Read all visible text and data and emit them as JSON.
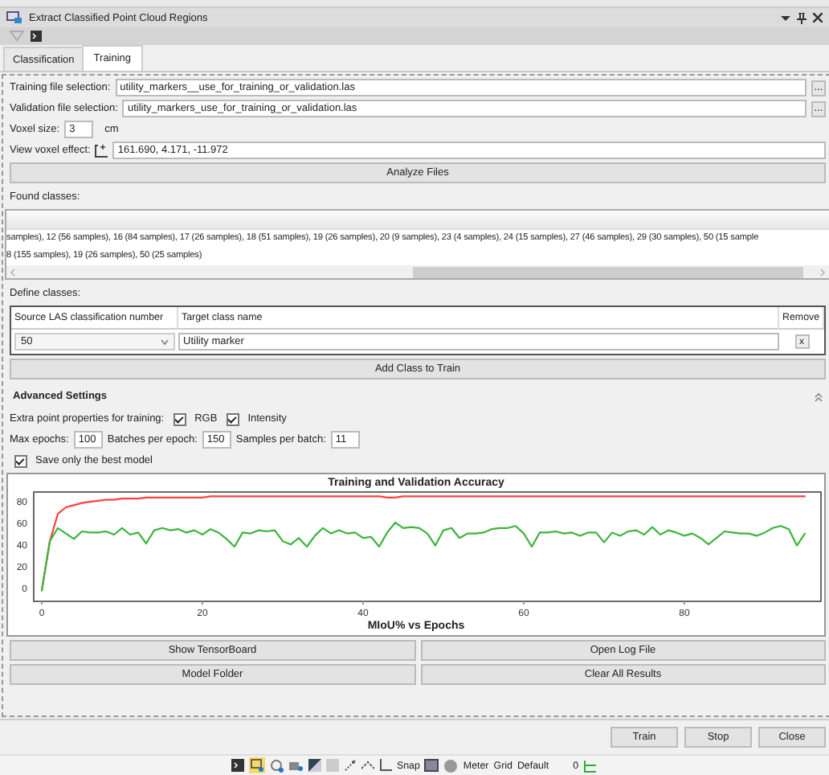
{
  "window": {
    "title": "Extract Classified Point Cloud Regions"
  },
  "tabs": [
    {
      "label": "Classification",
      "selected": false
    },
    {
      "label": "Training",
      "selected": true
    }
  ],
  "files": [
    {
      "label": "Training file selection:",
      "value": "utility_markers__use_for_training_or_validation.las",
      "browse": "..."
    },
    {
      "label": "Validation file selection:",
      "value": "utility_markers_use_for_training_or_validation.las",
      "browse": "..."
    }
  ],
  "voxel": {
    "label": "Voxel size:",
    "value": "3",
    "unit": "cm"
  },
  "view_voxel": {
    "label": "View voxel effect:",
    "value": "161.690, 4.171, -11.972"
  },
  "analyze_button": "Analyze Files",
  "found": {
    "label": "Found classes:",
    "lines": [
      "samples), 12 (56 samples), 16 (84 samples), 17 (26 samples), 18 (51 samples), 19 (26 samples), 20 (9 samples), 23 (4 samples), 24 (15 samples), 27 (46 samples), 29 (30 samples), 50 (15 sample",
      "8 (155 samples), 19 (26 samples), 50 (25 samples)"
    ]
  },
  "define": {
    "label": "Define classes:",
    "columns": [
      "Source LAS classification number",
      "Target class name",
      "Remove"
    ],
    "rows": [
      {
        "source": "50",
        "target": "Utility marker",
        "remove": "x"
      }
    ]
  },
  "add_button": "Add Class to Train",
  "advanced": {
    "title": "Advanced Settings",
    "extra_label": "Extra point properties for training:",
    "properties": [
      {
        "label": "RGB",
        "checked": true
      },
      {
        "label": "Intensity",
        "checked": true
      }
    ],
    "numbers": [
      {
        "label": "Max epochs:",
        "value": "100"
      },
      {
        "label": "Batches per epoch:",
        "value": "150"
      },
      {
        "label": "Samples per batch:",
        "value": "11"
      }
    ],
    "save_best": {
      "label": "Save only the best model",
      "checked": true
    }
  },
  "chart_data": {
    "type": "line",
    "title": "Training and Validation Accuracy",
    "xlabel": "MIoU% vs Epochs",
    "x": [
      0,
      1,
      2,
      3,
      4,
      5,
      6,
      7,
      8,
      9,
      10,
      11,
      12,
      13,
      14,
      15,
      16,
      17,
      18,
      19,
      20,
      21,
      22,
      23,
      24,
      25,
      26,
      27,
      28,
      29,
      30,
      31,
      32,
      33,
      34,
      35,
      36,
      37,
      38,
      39,
      40,
      41,
      42,
      43,
      44,
      45,
      46,
      47,
      48,
      49,
      50,
      51,
      52,
      53,
      54,
      55,
      56,
      57,
      58,
      59,
      60,
      61,
      62,
      63,
      64,
      65,
      66,
      67,
      68,
      69,
      70,
      71,
      72,
      73,
      74,
      75,
      76,
      77,
      78,
      79,
      80,
      81,
      82,
      83,
      84,
      85,
      86,
      87,
      88,
      89,
      90,
      91,
      92,
      93,
      94,
      95
    ],
    "series": [
      {
        "color": "#ff4040",
        "values": [
          0,
          45,
          70,
          76,
          78,
          80,
          81,
          82,
          83,
          83,
          84,
          84,
          84,
          85,
          85,
          85,
          85,
          85,
          85,
          85,
          85,
          86,
          86,
          86,
          86,
          86,
          86,
          86,
          86,
          86,
          86,
          86,
          86,
          86,
          86,
          86,
          86,
          86,
          86,
          86,
          86,
          86,
          86,
          85,
          85,
          86,
          86,
          86,
          86,
          86,
          86,
          86,
          86,
          86,
          86,
          86,
          86,
          86,
          86,
          86,
          86,
          86,
          86,
          86,
          86,
          86,
          86,
          86,
          86,
          86,
          86,
          86,
          86,
          86,
          86,
          86,
          86,
          86,
          86,
          86,
          86,
          86,
          86,
          86,
          86,
          86,
          86,
          86,
          86,
          86,
          86,
          86,
          86,
          86,
          86,
          86
        ]
      },
      {
        "color": "#3cb43c",
        "values": [
          0,
          45,
          57,
          52,
          47,
          54,
          53,
          53,
          54,
          51,
          57,
          51,
          53,
          43,
          55,
          57,
          55,
          56,
          53,
          55,
          51,
          56,
          53,
          47,
          40,
          53,
          52,
          55,
          54,
          55,
          45,
          42,
          48,
          40,
          50,
          57,
          52,
          55,
          52,
          53,
          48,
          49,
          40,
          53,
          62,
          57,
          58,
          57,
          52,
          41,
          55,
          57,
          48,
          52,
          52,
          53,
          56,
          57,
          57,
          59,
          52,
          40,
          53,
          53,
          54,
          52,
          53,
          50,
          53,
          53,
          44,
          53,
          50,
          54,
          55,
          51,
          58,
          51,
          55,
          53,
          50,
          52,
          48,
          42,
          48,
          54,
          53,
          52,
          52,
          50,
          53,
          57,
          59,
          56,
          41,
          52
        ]
      }
    ],
    "xlim": [
      -1,
      97
    ],
    "ylim": [
      -10,
      90
    ],
    "xticks": [
      0,
      20,
      40,
      60,
      80
    ],
    "yticks": [
      0,
      20,
      40,
      60,
      80
    ]
  },
  "result_buttons": [
    "Show TensorBoard",
    "Open Log File",
    "Model Folder",
    "Clear All Results"
  ],
  "dialog_buttons": [
    "Train",
    "Stop",
    "Close"
  ],
  "status_bar": {
    "snap": "Snap",
    "meter": "Meter",
    "grid": "Grid",
    "default": "Default",
    "count": "0"
  }
}
